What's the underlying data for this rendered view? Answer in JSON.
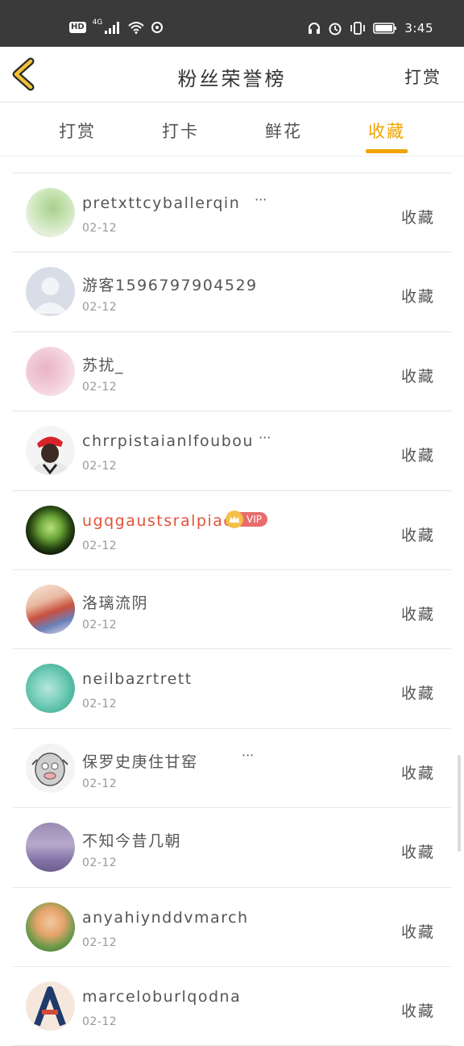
{
  "status_bar": {
    "hd": "HD",
    "network": "4G",
    "time": "3:45",
    "icons": [
      "signal-icon",
      "wifi-icon",
      "sync-icon",
      "headset-icon",
      "alarm-icon",
      "vibrate-icon",
      "battery-icon"
    ]
  },
  "header": {
    "back_icon": "chevron-left-icon",
    "title": "粉丝荣誉榜",
    "action": "打赏"
  },
  "tabs": [
    {
      "label": "打赏",
      "active": false
    },
    {
      "label": "打卡",
      "active": false
    },
    {
      "label": "鲜花",
      "active": false
    },
    {
      "label": "收藏",
      "active": true
    }
  ],
  "colors": {
    "accent": "#f0a400",
    "vip_name": "#e2523b",
    "status_bar": "#3a3a3a"
  },
  "rows": [
    {
      "name": "pretxttcyballerqin",
      "more": "···",
      "date": "02-12",
      "tag": "收藏",
      "vip": false
    },
    {
      "name": "游客1596797904529",
      "more": "",
      "date": "02-12",
      "tag": "收藏",
      "vip": false
    },
    {
      "name": "苏扰_",
      "more": "",
      "date": "02-12",
      "tag": "收藏",
      "vip": false
    },
    {
      "name": "chrrpistaianlfoubou",
      "more": "···",
      "date": "02-12",
      "tag": "收藏",
      "vip": false
    },
    {
      "name": "ugqgaustsralpiae",
      "more": "",
      "date": "02-12",
      "tag": "收藏",
      "vip": true,
      "vip_label": "VIP"
    },
    {
      "name": "洛璃流阴",
      "more": "",
      "date": "02-12",
      "tag": "收藏",
      "vip": false
    },
    {
      "name": "neilbazrtrett",
      "more": "",
      "date": "02-12",
      "tag": "收藏",
      "vip": false
    },
    {
      "name": "保罗史庚住甘窑",
      "more": "···",
      "date": "02-12",
      "tag": "收藏",
      "vip": false
    },
    {
      "name": "不知今昔几朝",
      "more": "",
      "date": "02-12",
      "tag": "收藏",
      "vip": false
    },
    {
      "name": "anyahiynddvmarch",
      "more": "",
      "date": "02-12",
      "tag": "收藏",
      "vip": false
    },
    {
      "name": "marceloburlqodna",
      "more": "",
      "date": "02-12",
      "tag": "收藏",
      "vip": false
    }
  ]
}
